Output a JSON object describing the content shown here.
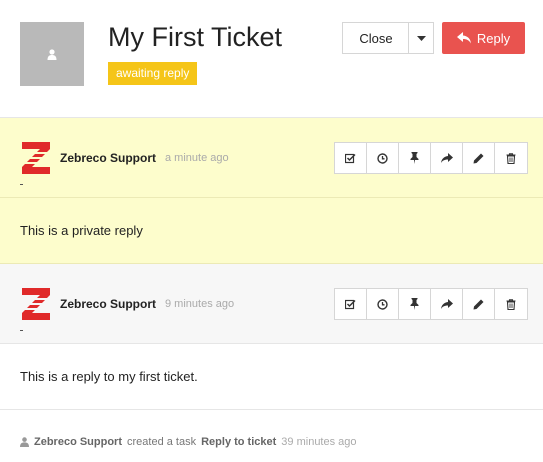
{
  "ticket": {
    "title": "My First Ticket",
    "status": "awaiting reply",
    "status_color": "#f5c518"
  },
  "toolbar": {
    "close_label": "Close",
    "reply_label": "Reply",
    "reply_color": "#e9534f"
  },
  "messages": [
    {
      "author": "Zebreco Support",
      "time": "a minute ago",
      "body": "This is a private reply",
      "type": "private",
      "background": "#fdfdcc"
    },
    {
      "author": "Zebreco Support",
      "time": "9 minutes ago",
      "body": "This is a reply to my first ticket.",
      "type": "public",
      "background": "#ffffff"
    }
  ],
  "message_actions": [
    "checkbox-icon",
    "clock-icon",
    "pin-icon",
    "forward-icon",
    "pencil-icon",
    "trash-icon"
  ],
  "activity": {
    "actor": "Zebreco Support",
    "text": "created a task",
    "task": "Reply to ticket",
    "time": "39 minutes ago"
  }
}
